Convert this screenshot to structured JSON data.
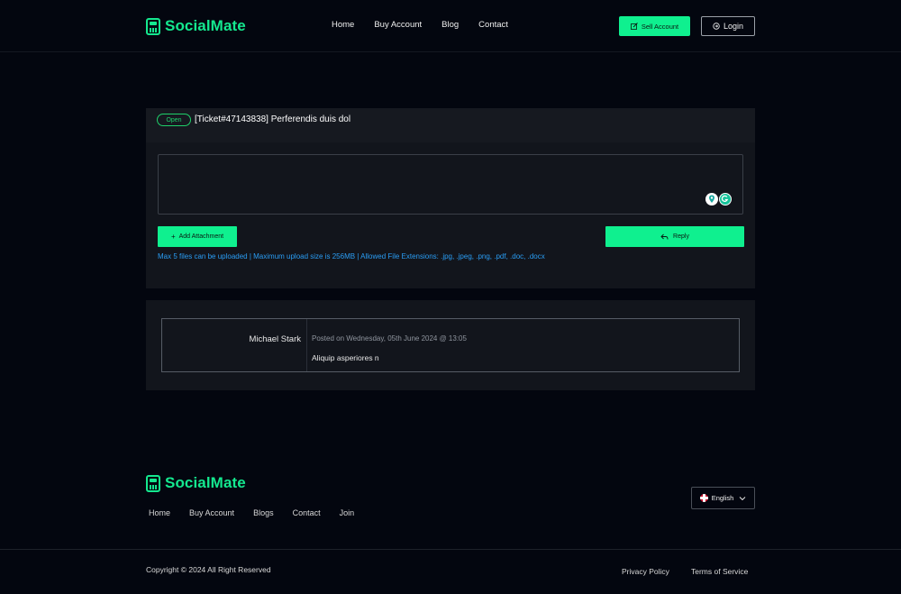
{
  "brand": {
    "name": "SocialMate",
    "color": "#14e88f"
  },
  "nav": {
    "items": [
      "Home",
      "Buy Account",
      "Blog",
      "Contact"
    ]
  },
  "header": {
    "sell_label": "Sell Account",
    "login_label": "Login",
    "sell_icon": "edit-icon",
    "login_icon": "login-icon"
  },
  "ticket": {
    "status": "Open",
    "title": "[Ticket#47143838] Perferendis duis dol",
    "reply_placeholder": "",
    "attach_label": "Add Attachment",
    "reply_label": "Reply",
    "upload_note": "Max 5 files can be uploaded | Maximum upload size is 256MB | Allowed File Extensions: .jpg, .jpeg, .png, .pdf, .doc, .docx"
  },
  "messages": [
    {
      "author": "Michael Stark",
      "posted": "Posted on Wednesday, 05th June 2024 @ 13:05",
      "body": "Aliquip asperiores n"
    }
  ],
  "footer": {
    "nav": [
      "Home",
      "Buy Account",
      "Blogs",
      "Contact",
      "Join"
    ],
    "language": "English",
    "copyright": "Copyright © 2024 All Right Reserved",
    "privacy": "Privacy Policy",
    "terms": "Terms of Service"
  },
  "colors": {
    "accent": "#0ff08f",
    "background": "#03060f",
    "card": "#12151c",
    "link": "#2a9df4",
    "status_open": "#1fd06a"
  }
}
